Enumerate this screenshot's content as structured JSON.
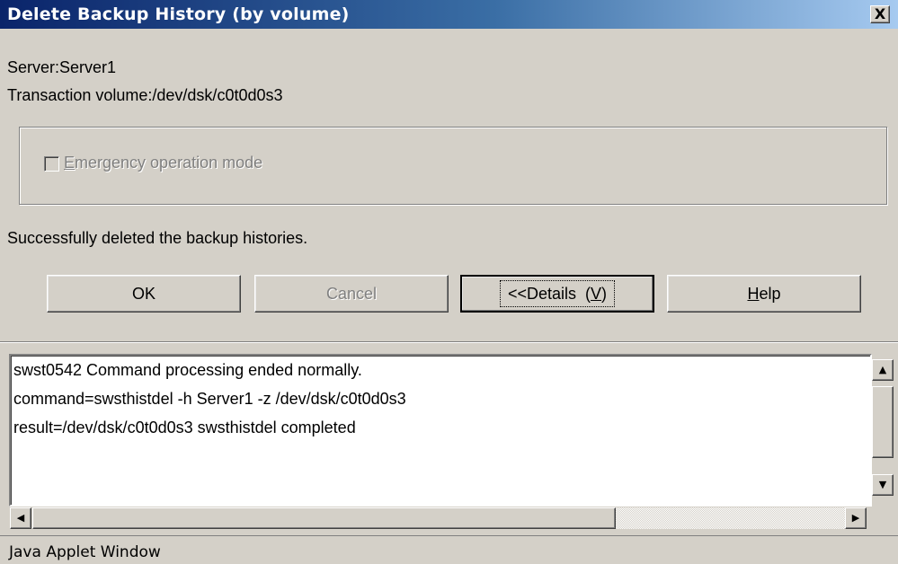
{
  "window": {
    "title": "Delete Backup History (by volume)",
    "close_symbol": "X"
  },
  "info": {
    "server": "Server:Server1",
    "transaction_volume": "Transaction volume:/dev/dsk/c0t0d0s3"
  },
  "options": {
    "emergency_mode": {
      "label_mnemonic": "E",
      "label_rest": "mergency operation mode",
      "checked": false,
      "enabled": false
    }
  },
  "message": "Successfully deleted the backup histories.",
  "buttons": {
    "ok": "OK",
    "cancel": "Cancel",
    "details_prefix": "<<Details  (",
    "details_mnemonic": "V",
    "details_suffix": ")",
    "help_mnemonic": "H",
    "help_rest": "elp"
  },
  "details": {
    "lines": [
      "swst0542 Command processing ended normally.",
      "command=swsthistdel -h Server1 -z /dev/dsk/c0t0d0s3",
      "result=/dev/dsk/c0t0d0s3 swsthistdel completed"
    ]
  },
  "icons": {
    "scroll_up": "▲",
    "scroll_down": "▼",
    "scroll_left": "◀",
    "scroll_right": "▶"
  },
  "status_bar": {
    "text": "Java Applet Window"
  },
  "colors": {
    "title_start": "#0a246a",
    "title_end": "#a6caf0",
    "face": "#d4d0c8"
  }
}
